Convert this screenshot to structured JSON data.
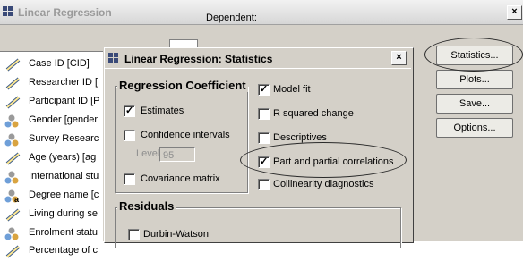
{
  "outer_window": {
    "title": "Linear Regression",
    "close_glyph": "×"
  },
  "dependent_label": "Dependent:",
  "variables": [
    {
      "label": "Case ID [CID]",
      "icon": "ruler-icon"
    },
    {
      "label": "Researcher ID [",
      "icon": "ruler-icon"
    },
    {
      "label": "Participant ID [P",
      "icon": "ruler-icon"
    },
    {
      "label": "Gender [gender",
      "icon": "nominal-icon"
    },
    {
      "label": "Survey Researc",
      "icon": "nominal-icon"
    },
    {
      "label": "Age (years) [ag",
      "icon": "ruler-icon"
    },
    {
      "label": "International stu",
      "icon": "nominal-icon"
    },
    {
      "label": "Degree name [c",
      "icon": "string-nominal-icon"
    },
    {
      "label": "Living during se",
      "icon": "ruler-icon"
    },
    {
      "label": "Enrolment statu",
      "icon": "nominal-icon"
    },
    {
      "label": "Percentage of c",
      "icon": "ruler-icon"
    }
  ],
  "right_buttons": [
    {
      "label": "Statistics...",
      "accel": "S"
    },
    {
      "label": "Plots...",
      "accel": "t"
    },
    {
      "label": "Save...",
      "accel": "v"
    },
    {
      "label": "Options...",
      "accel": "O"
    }
  ],
  "stats_dialog": {
    "title": "Linear Regression: Statistics",
    "close_glyph": "×",
    "regression_group": {
      "title": "Regression Coefficient",
      "estimates": {
        "label": "Estimates",
        "checked": true
      },
      "confidence": {
        "label": "Confidence intervals",
        "checked": false
      },
      "level_label": "Level(%):",
      "level_value": "95",
      "covariance": {
        "label": "Covariance matrix",
        "checked": false
      }
    },
    "right_options": [
      {
        "label": "Model fit",
        "checked": true
      },
      {
        "label": "R squared change",
        "checked": false
      },
      {
        "label": "Descriptives",
        "checked": false
      },
      {
        "label": "Part and partial correlations",
        "checked": true
      },
      {
        "label": "Collinearity diagnostics",
        "checked": false
      }
    ],
    "residuals_group": {
      "title": "Residuals",
      "durbin": {
        "label": "Durbin-Watson",
        "checked": false
      }
    }
  },
  "colors": {
    "dialog_face": "#d4d0c8",
    "disabled_text": "#8e8e8e"
  }
}
